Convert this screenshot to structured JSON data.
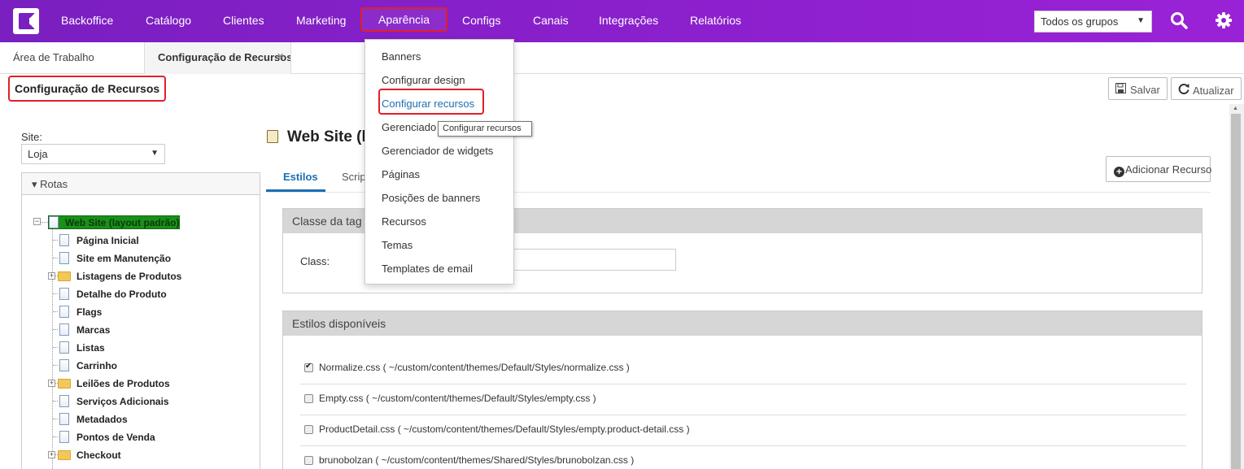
{
  "topnav": {
    "items": [
      "Backoffice",
      "Catálogo",
      "Clientes",
      "Marketing",
      "Aparência",
      "Configs",
      "Canais",
      "Integrações",
      "Relatórios"
    ],
    "group_select": "Todos os grupos",
    "search_icon": "search-icon",
    "settings_icon": "gear-icon"
  },
  "tabs": {
    "home": "Área de Trabalho",
    "current": "Configuração de Recursos",
    "close": "×"
  },
  "page": {
    "title": "Configuração de Recursos",
    "save_label": "Salvar",
    "refresh_label": "Atualizar"
  },
  "sidebar": {
    "site_label": "Site:",
    "site_value": "Loja",
    "rotas_label": "▾ Rotas",
    "root": "Web Site (layout padrão)",
    "items": [
      {
        "label": "Página Inicial",
        "type": "page"
      },
      {
        "label": "Site em Manutenção",
        "type": "page"
      },
      {
        "label": "Listagens de Produtos",
        "type": "folder"
      },
      {
        "label": "Detalhe do Produto",
        "type": "page"
      },
      {
        "label": "Flags",
        "type": "page"
      },
      {
        "label": "Marcas",
        "type": "page"
      },
      {
        "label": "Listas",
        "type": "page"
      },
      {
        "label": "Carrinho",
        "type": "page"
      },
      {
        "label": "Leilões de Produtos",
        "type": "folder"
      },
      {
        "label": "Serviços Adicionais",
        "type": "page"
      },
      {
        "label": "Metadados",
        "type": "page"
      },
      {
        "label": "Pontos de Venda",
        "type": "page"
      },
      {
        "label": "Checkout",
        "type": "folder"
      }
    ]
  },
  "main": {
    "title": "Web Site (la",
    "subtabs": [
      "Estilos",
      "Scrip"
    ],
    "add_button": "Adicionar Recurso",
    "tag_panel_title": "Classe da tag",
    "class_label": "Class:",
    "styles_panel_title": "Estilos disponíveis",
    "styles": [
      {
        "text": "Normalize.css ( ~/custom/content/themes/Default/Styles/normalize.css )",
        "checked": true
      },
      {
        "text": "Empty.css ( ~/custom/content/themes/Default/Styles/empty.css )",
        "checked": false
      },
      {
        "text": "ProductDetail.css ( ~/custom/content/themes/Default/Styles/empty.product-detail.css )",
        "checked": false
      },
      {
        "text": "brunobolzan ( ~/custom/content/themes/Shared/Styles/brunobolzan.css )",
        "checked": false
      }
    ]
  },
  "dropdown": {
    "items": [
      "Banners",
      "Configurar design",
      "Configurar recursos",
      "Gerenciado",
      "Gerenciador de widgets",
      "Páginas",
      "Posições de banners",
      "Recursos",
      "Temas",
      "Templates de email"
    ],
    "highlighted_index": 2,
    "tooltip": "Configurar recursos"
  },
  "colors": {
    "nav_bg": "#8a20cc",
    "highlight_red": "#e0202a",
    "link_blue": "#1c6fb3",
    "tree_selected": "#1a8f1a"
  }
}
